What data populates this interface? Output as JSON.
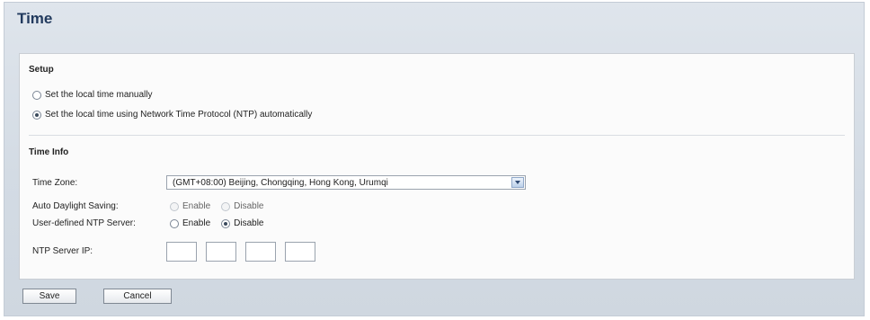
{
  "page": {
    "title": "Time"
  },
  "setup": {
    "section_title": "Setup",
    "options": [
      {
        "label": "Set the local time manually",
        "checked": false
      },
      {
        "label": "Set the local time using Network Time Protocol (NTP) automatically",
        "checked": true
      }
    ]
  },
  "time_info": {
    "section_title": "Time Info",
    "time_zone": {
      "label": "Time Zone:",
      "selected": "(GMT+08:00) Beijing, Chongqing, Hong Kong, Urumqi"
    },
    "auto_daylight_saving": {
      "label": "Auto Daylight Saving:",
      "enable_label": "Enable",
      "disable_label": "Disable",
      "disabled": true
    },
    "user_defined_ntp": {
      "label": "User-defined NTP Server:",
      "enable_label": "Enable",
      "disable_label": "Disable",
      "selected": "Disable"
    },
    "ntp_server_ip": {
      "label": "NTP Server IP:",
      "octets": [
        "",
        "",
        "",
        ""
      ]
    }
  },
  "buttons": {
    "save": "Save",
    "cancel": "Cancel"
  },
  "colors": {
    "title": "#223a5e",
    "background": "#d3dbe4",
    "panel": "#fbfbfb"
  }
}
